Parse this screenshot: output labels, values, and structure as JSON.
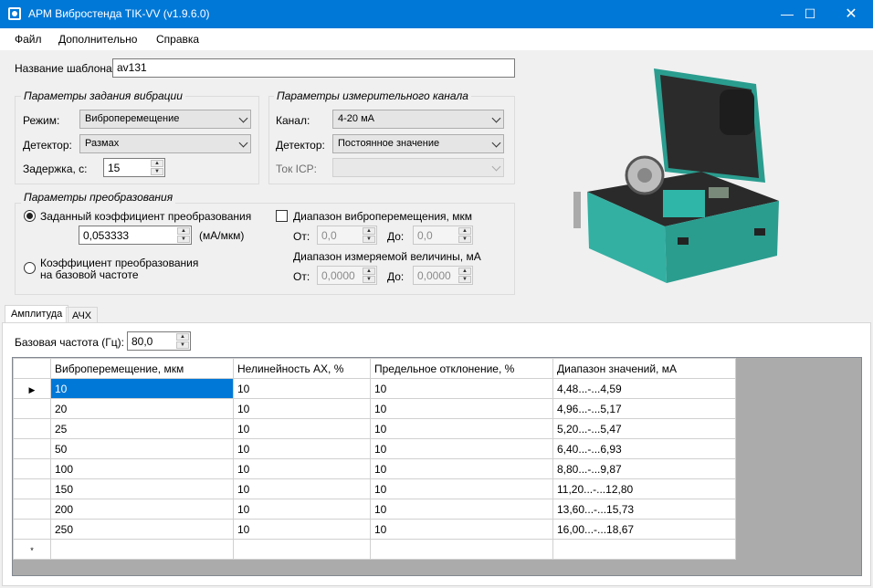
{
  "window": {
    "title": "АРМ Вибростенда TIK-VV (v1.9.6.0)"
  },
  "menu": [
    "Файл",
    "Дополнительно",
    "Справка"
  ],
  "template": {
    "label": "Название шаблона:",
    "value": "av131"
  },
  "vibration_params": {
    "title": "Параметры задания вибрации",
    "mode_label": "Режим:",
    "mode_value": "Виброперемещение",
    "detector_label": "Детектор:",
    "detector_value": "Размах",
    "delay_label": "Задержка, с:",
    "delay_value": "15"
  },
  "channel_params": {
    "title": "Параметры измерительного канала",
    "channel_label": "Канал:",
    "channel_value": "4-20 мА",
    "detector_label": "Детектор:",
    "detector_value": "Постоянное значение",
    "icp_label": "Ток ICP:",
    "icp_value": ""
  },
  "conversion": {
    "title": "Параметры преобразования",
    "option_fixed": "Заданный коэффициент преобразования",
    "coef_value": "0,053333",
    "coef_unit": "(мА/мкм)",
    "option_base_line1": "Коэффициент преобразования",
    "option_base_line2": "на базовой частоте",
    "range_disp_label": "Диапазон виброперемещения, мкм",
    "from_label": "От:",
    "to_label": "До:",
    "disp_from": "0,0",
    "disp_to": "0,0",
    "range_meas_label": "Диапазон измеряемой величины, мА",
    "meas_from": "0,0000",
    "meas_to": "0,0000"
  },
  "tabs": [
    "Амплитуда",
    "АЧХ"
  ],
  "base_freq": {
    "label": "Базовая частота (Гц):",
    "value": "80,0"
  },
  "grid": {
    "columns": [
      "Виброперемещение, мкм",
      "Нелинейность АХ, %",
      "Предельное отклонение, %",
      "Диапазон значений, мА"
    ],
    "rows": [
      [
        "10",
        "10",
        "10",
        "4,48...-...4,59"
      ],
      [
        "20",
        "10",
        "10",
        "4,96...-...5,17"
      ],
      [
        "25",
        "10",
        "10",
        "5,20...-...5,47"
      ],
      [
        "50",
        "10",
        "10",
        "6,40...-...6,93"
      ],
      [
        "100",
        "10",
        "10",
        "8,80...-...9,87"
      ],
      [
        "150",
        "10",
        "10",
        "11,20...-...12,80"
      ],
      [
        "200",
        "10",
        "10",
        "13,60...-...15,73"
      ],
      [
        "250",
        "10",
        "10",
        "16,00...-...18,67"
      ]
    ],
    "current_row_marker": "▶",
    "new_row_marker": "*"
  },
  "colors": {
    "titlebar": "#0078d7",
    "device_case": "#2fa89a",
    "selection": "#0078d7"
  }
}
